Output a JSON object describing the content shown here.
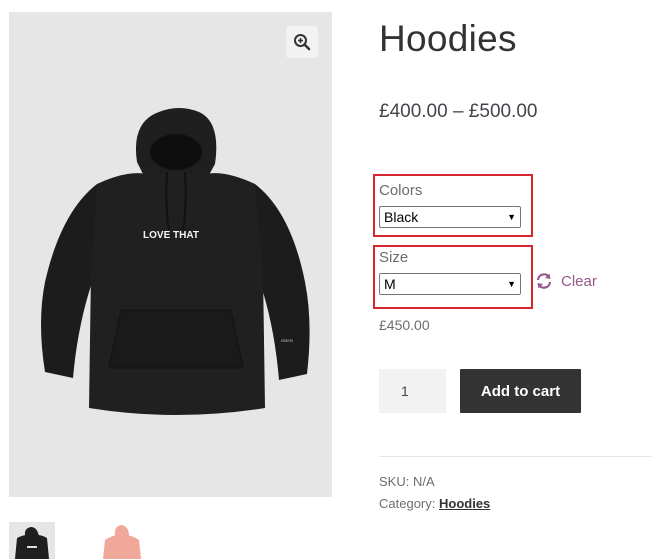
{
  "product": {
    "title": "Hoodies",
    "price_range": "£400.00 – £500.00",
    "variant_price": "£450.00",
    "print_text": "LOVE THAT",
    "sleeve_text": "sisters"
  },
  "variations": {
    "colors_label": "Colors",
    "colors_selected": "Black",
    "size_label": "Size",
    "size_selected": "M",
    "clear_label": "Clear"
  },
  "cart": {
    "quantity": "1",
    "add_to_cart_label": "Add to cart"
  },
  "meta": {
    "sku_label": "SKU:",
    "sku_value": "N/A",
    "category_label": "Category:",
    "category_value": "Hoodies"
  },
  "colors": {
    "highlight": "#d6262f",
    "link": "#96588a",
    "button_bg": "#333333",
    "hoodie_black": "#1f1f1f",
    "hoodie_pink": "#f0a89a"
  },
  "icons": {
    "zoom": "zoom-in-icon",
    "clear": "refresh-icon"
  }
}
